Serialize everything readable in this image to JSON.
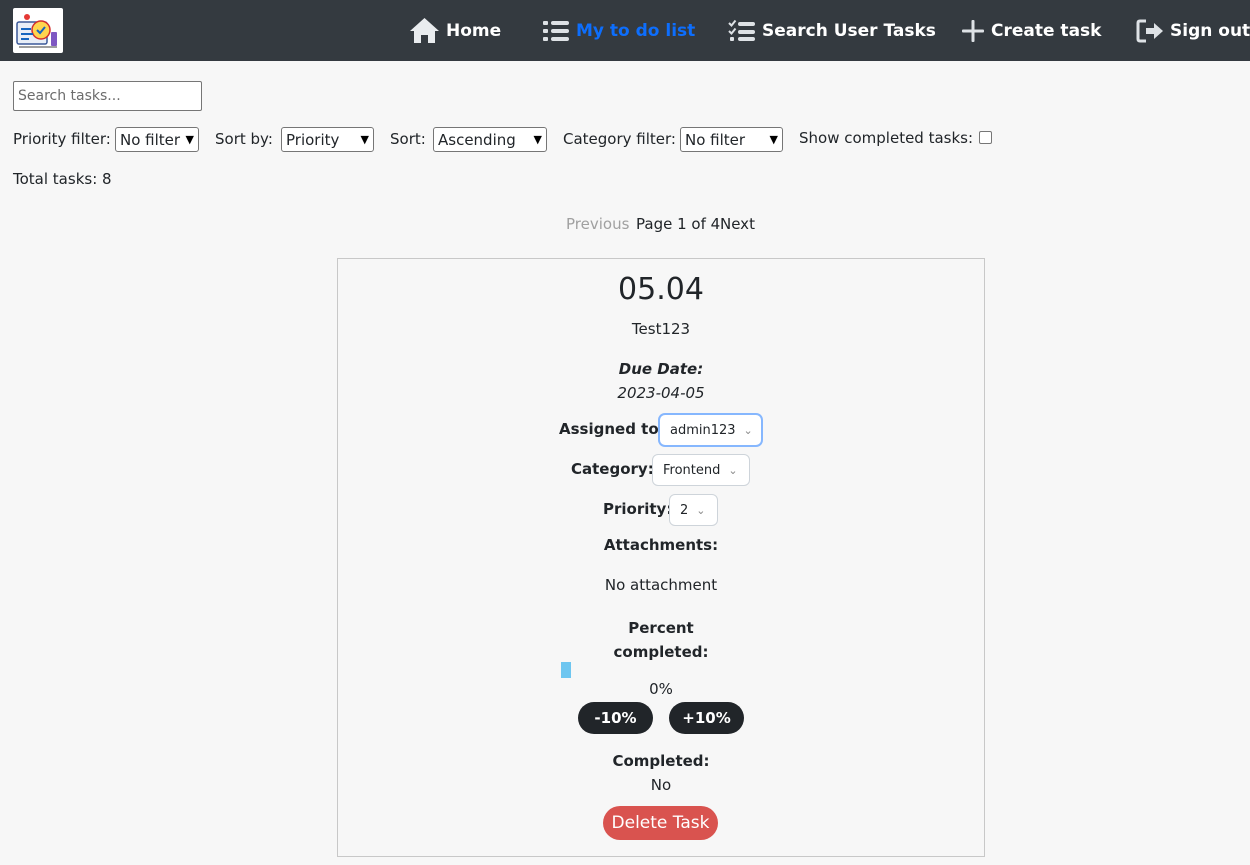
{
  "nav": {
    "home": "Home",
    "todo": "My to do list",
    "search_tasks": "Search User Tasks",
    "create": "Create task",
    "signout": "Sign out",
    "active_color": "#0d6efd"
  },
  "filters": {
    "search_placeholder": "Search tasks...",
    "priority_label": "Priority filter:",
    "priority_value": "No filter",
    "sortby_label": "Sort by:",
    "sortby_value": "Priority",
    "sort_label": "Sort:",
    "sort_value": "Ascending",
    "category_label": "Category filter:",
    "category_value": "No filter",
    "show_completed_label": "Show completed tasks:",
    "show_completed_checked": false
  },
  "total": "Total tasks: 8",
  "pagination": {
    "previous": "Previous",
    "info": "Page 1 of 4",
    "next": "Next"
  },
  "task": {
    "title": "05.04",
    "description": "Test123",
    "due_label": "Due Date:",
    "due_value": "2023-04-05",
    "assigned_label": "Assigned to:",
    "assigned_value": "admin123",
    "category_label": "Category:",
    "category_value": "Frontend",
    "priority_label": "Priority:",
    "priority_value": "2",
    "attachments_label": "Attachments:",
    "attachments_value": "No attachment",
    "percent_label_1": "Percent",
    "percent_label_2": "completed:",
    "percent_value": "0%",
    "minus_label": "-10%",
    "plus_label": "+10%",
    "completed_label": "Completed:",
    "completed_value": "No",
    "delete_label": "Delete Task",
    "delete_color": "#d9534f",
    "progress_color": "#6ec6f0"
  }
}
